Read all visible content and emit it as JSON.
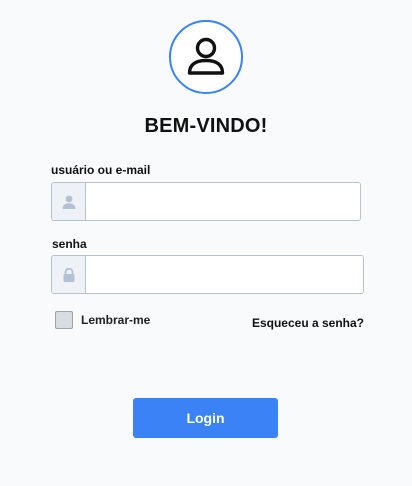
{
  "header": {
    "avatar_icon": "user-icon",
    "title": "BEM-VINDO!"
  },
  "form": {
    "username": {
      "label": "usuário ou e-mail",
      "icon": "user-icon",
      "value": "",
      "placeholder": ""
    },
    "password": {
      "label": "senha",
      "icon": "lock-icon",
      "value": "",
      "placeholder": ""
    },
    "remember": {
      "label": "Lembrar-me",
      "checked": false
    },
    "forgot_label": "Esqueceu a senha?",
    "login_label": "Login"
  },
  "colors": {
    "accent": "#3b82f6",
    "background": "#f9fafb",
    "addon_icon": "#b3c1d3"
  }
}
